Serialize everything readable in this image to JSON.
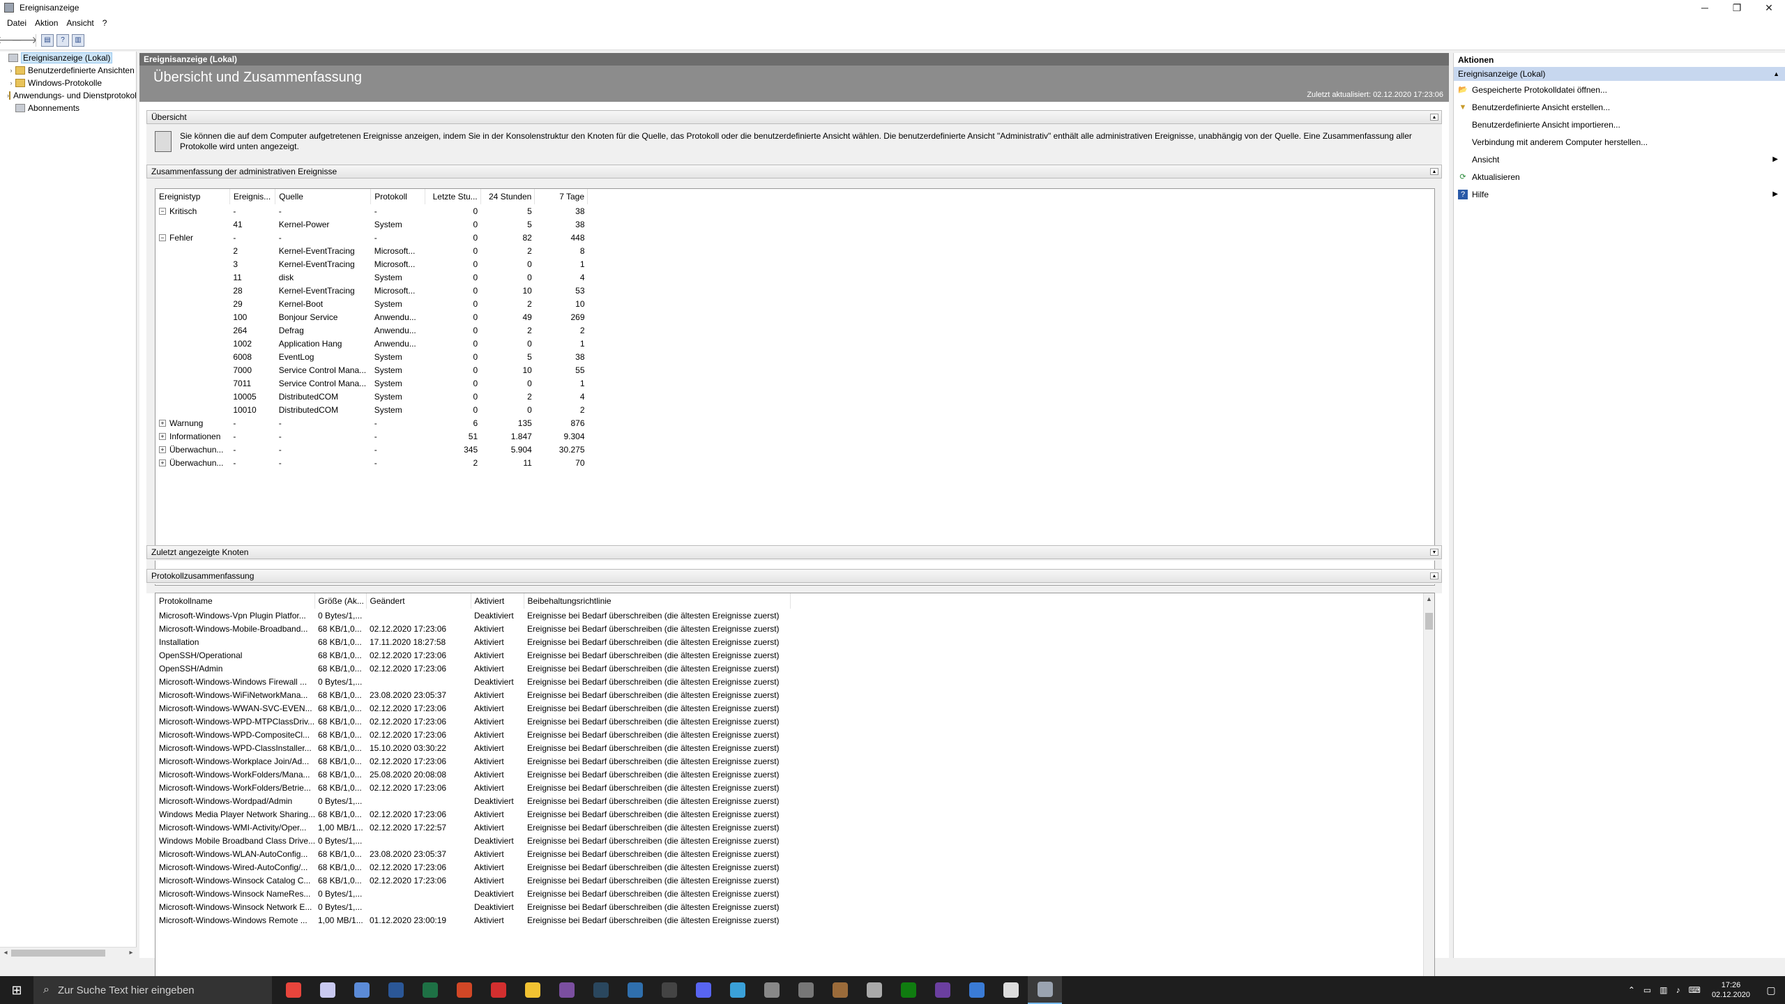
{
  "window": {
    "title": "Ereignisanzeige",
    "minimize": "─",
    "maximize": "❐",
    "close": "✕"
  },
  "menu": [
    "Datei",
    "Aktion",
    "Ansicht",
    "?"
  ],
  "toolbar": {
    "back": "🡐",
    "forward": "🡒",
    "help": "?"
  },
  "tree": {
    "root": "Ereignisanzeige (Lokal)",
    "items": [
      "Benutzerdefinierte Ansichten",
      "Windows-Protokolle",
      "Anwendungs- und Dienstprotokolle",
      "Abonnements"
    ]
  },
  "center": {
    "header": "Ereignisanzeige (Lokal)",
    "banner_title": "Übersicht und Zusammenfassung",
    "last_updated": "Zuletzt aktualisiert: 02.12.2020 17:23:06",
    "overview": {
      "title": "Übersicht",
      "text": "Sie können die auf dem Computer aufgetretenen Ereignisse anzeigen, indem Sie in der Konsolenstruktur den Knoten für die Quelle, das Protokoll oder die benutzerdefinierte Ansicht wählen. Die benutzerdefinierte Ansicht \"Administrativ\" enthält alle administrativen Ereignisse, unabhängig von der Quelle. Eine Zusammenfassung aller Protokolle wird unten angezeigt."
    },
    "admin_summary": {
      "title": "Zusammenfassung der administrativen Ereignisse",
      "columns": [
        "Ereignistyp",
        "Ereignis...",
        "Quelle",
        "Protokoll",
        "Letzte Stu...",
        "24 Stunden",
        "7 Tage"
      ],
      "rows": [
        {
          "type": "Kritisch",
          "toggle": "−",
          "id": "-",
          "source": "-",
          "log": "-",
          "hour": "0",
          "day": "5",
          "week": "38"
        },
        {
          "type": "",
          "toggle": "",
          "id": "41",
          "source": "Kernel-Power",
          "log": "System",
          "hour": "0",
          "day": "5",
          "week": "38"
        },
        {
          "type": "Fehler",
          "toggle": "−",
          "id": "-",
          "source": "-",
          "log": "-",
          "hour": "0",
          "day": "82",
          "week": "448"
        },
        {
          "type": "",
          "toggle": "",
          "id": "2",
          "source": "Kernel-EventTracing",
          "log": "Microsoft...",
          "hour": "0",
          "day": "2",
          "week": "8"
        },
        {
          "type": "",
          "toggle": "",
          "id": "3",
          "source": "Kernel-EventTracing",
          "log": "Microsoft...",
          "hour": "0",
          "day": "0",
          "week": "1"
        },
        {
          "type": "",
          "toggle": "",
          "id": "11",
          "source": "disk",
          "log": "System",
          "hour": "0",
          "day": "0",
          "week": "4"
        },
        {
          "type": "",
          "toggle": "",
          "id": "28",
          "source": "Kernel-EventTracing",
          "log": "Microsoft...",
          "hour": "0",
          "day": "10",
          "week": "53"
        },
        {
          "type": "",
          "toggle": "",
          "id": "29",
          "source": "Kernel-Boot",
          "log": "System",
          "hour": "0",
          "day": "2",
          "week": "10"
        },
        {
          "type": "",
          "toggle": "",
          "id": "100",
          "source": "Bonjour Service",
          "log": "Anwendu...",
          "hour": "0",
          "day": "49",
          "week": "269"
        },
        {
          "type": "",
          "toggle": "",
          "id": "264",
          "source": "Defrag",
          "log": "Anwendu...",
          "hour": "0",
          "day": "2",
          "week": "2"
        },
        {
          "type": "",
          "toggle": "",
          "id": "1002",
          "source": "Application Hang",
          "log": "Anwendu...",
          "hour": "0",
          "day": "0",
          "week": "1"
        },
        {
          "type": "",
          "toggle": "",
          "id": "6008",
          "source": "EventLog",
          "log": "System",
          "hour": "0",
          "day": "5",
          "week": "38"
        },
        {
          "type": "",
          "toggle": "",
          "id": "7000",
          "source": "Service Control Mana...",
          "log": "System",
          "hour": "0",
          "day": "10",
          "week": "55"
        },
        {
          "type": "",
          "toggle": "",
          "id": "7011",
          "source": "Service Control Mana...",
          "log": "System",
          "hour": "0",
          "day": "0",
          "week": "1"
        },
        {
          "type": "",
          "toggle": "",
          "id": "10005",
          "source": "DistributedCOM",
          "log": "System",
          "hour": "0",
          "day": "2",
          "week": "4"
        },
        {
          "type": "",
          "toggle": "",
          "id": "10010",
          "source": "DistributedCOM",
          "log": "System",
          "hour": "0",
          "day": "0",
          "week": "2"
        },
        {
          "type": "Warnung",
          "toggle": "+",
          "id": "-",
          "source": "-",
          "log": "-",
          "hour": "6",
          "day": "135",
          "week": "876"
        },
        {
          "type": "Informationen",
          "toggle": "+",
          "id": "-",
          "source": "-",
          "log": "-",
          "hour": "51",
          "day": "1.847",
          "week": "9.304"
        },
        {
          "type": "Überwachun...",
          "toggle": "+",
          "id": "-",
          "source": "-",
          "log": "-",
          "hour": "345",
          "day": "5.904",
          "week": "30.275"
        },
        {
          "type": "Überwachun...",
          "toggle": "+",
          "id": "-",
          "source": "-",
          "log": "-",
          "hour": "2",
          "day": "11",
          "week": "70"
        }
      ]
    },
    "recent_nodes": {
      "title": "Zuletzt angezeigte Knoten"
    },
    "log_summary": {
      "title": "Protokollzusammenfassung",
      "columns": [
        "Protokollname",
        "Größe (Ak...",
        "Geändert",
        "Aktiviert",
        "Beibehaltungsrichtlinie"
      ],
      "rows": [
        [
          "Microsoft-Windows-Vpn Plugin Platfor...",
          "0 Bytes/1,...",
          "",
          "Deaktiviert",
          "Ereignisse bei Bedarf überschreiben (die ältesten Ereignisse zuerst)"
        ],
        [
          "Microsoft-Windows-Mobile-Broadband...",
          "68 KB/1,0...",
          "02.12.2020 17:23:06",
          "Aktiviert",
          "Ereignisse bei Bedarf überschreiben (die ältesten Ereignisse zuerst)"
        ],
        [
          "Installation",
          "68 KB/1,0...",
          "17.11.2020 18:27:58",
          "Aktiviert",
          "Ereignisse bei Bedarf überschreiben (die ältesten Ereignisse zuerst)"
        ],
        [
          "OpenSSH/Operational",
          "68 KB/1,0...",
          "02.12.2020 17:23:06",
          "Aktiviert",
          "Ereignisse bei Bedarf überschreiben (die ältesten Ereignisse zuerst)"
        ],
        [
          "OpenSSH/Admin",
          "68 KB/1,0...",
          "02.12.2020 17:23:06",
          "Aktiviert",
          "Ereignisse bei Bedarf überschreiben (die ältesten Ereignisse zuerst)"
        ],
        [
          "Microsoft-Windows-Windows Firewall ...",
          "0 Bytes/1,...",
          "",
          "Deaktiviert",
          "Ereignisse bei Bedarf überschreiben (die ältesten Ereignisse zuerst)"
        ],
        [
          "Microsoft-Windows-WiFiNetworkMana...",
          "68 KB/1,0...",
          "23.08.2020 23:05:37",
          "Aktiviert",
          "Ereignisse bei Bedarf überschreiben (die ältesten Ereignisse zuerst)"
        ],
        [
          "Microsoft-Windows-WWAN-SVC-EVEN...",
          "68 KB/1,0...",
          "02.12.2020 17:23:06",
          "Aktiviert",
          "Ereignisse bei Bedarf überschreiben (die ältesten Ereignisse zuerst)"
        ],
        [
          "Microsoft-Windows-WPD-MTPClassDriv...",
          "68 KB/1,0...",
          "02.12.2020 17:23:06",
          "Aktiviert",
          "Ereignisse bei Bedarf überschreiben (die ältesten Ereignisse zuerst)"
        ],
        [
          "Microsoft-Windows-WPD-CompositeCl...",
          "68 KB/1,0...",
          "02.12.2020 17:23:06",
          "Aktiviert",
          "Ereignisse bei Bedarf überschreiben (die ältesten Ereignisse zuerst)"
        ],
        [
          "Microsoft-Windows-WPD-ClassInstaller...",
          "68 KB/1,0...",
          "15.10.2020 03:30:22",
          "Aktiviert",
          "Ereignisse bei Bedarf überschreiben (die ältesten Ereignisse zuerst)"
        ],
        [
          "Microsoft-Windows-Workplace Join/Ad...",
          "68 KB/1,0...",
          "02.12.2020 17:23:06",
          "Aktiviert",
          "Ereignisse bei Bedarf überschreiben (die ältesten Ereignisse zuerst)"
        ],
        [
          "Microsoft-Windows-WorkFolders/Mana...",
          "68 KB/1,0...",
          "25.08.2020 20:08:08",
          "Aktiviert",
          "Ereignisse bei Bedarf überschreiben (die ältesten Ereignisse zuerst)"
        ],
        [
          "Microsoft-Windows-WorkFolders/Betrie...",
          "68 KB/1,0...",
          "02.12.2020 17:23:06",
          "Aktiviert",
          "Ereignisse bei Bedarf überschreiben (die ältesten Ereignisse zuerst)"
        ],
        [
          "Microsoft-Windows-Wordpad/Admin",
          "0 Bytes/1,...",
          "",
          "Deaktiviert",
          "Ereignisse bei Bedarf überschreiben (die ältesten Ereignisse zuerst)"
        ],
        [
          "Windows Media Player Network Sharing...",
          "68 KB/1,0...",
          "02.12.2020 17:23:06",
          "Aktiviert",
          "Ereignisse bei Bedarf überschreiben (die ältesten Ereignisse zuerst)"
        ],
        [
          "Microsoft-Windows-WMI-Activity/Oper...",
          "1,00 MB/1...",
          "02.12.2020 17:22:57",
          "Aktiviert",
          "Ereignisse bei Bedarf überschreiben (die ältesten Ereignisse zuerst)"
        ],
        [
          "Windows Mobile Broadband Class Drive...",
          "0 Bytes/1,...",
          "",
          "Deaktiviert",
          "Ereignisse bei Bedarf überschreiben (die ältesten Ereignisse zuerst)"
        ],
        [
          "Microsoft-Windows-WLAN-AutoConfig...",
          "68 KB/1,0...",
          "23.08.2020 23:05:37",
          "Aktiviert",
          "Ereignisse bei Bedarf überschreiben (die ältesten Ereignisse zuerst)"
        ],
        [
          "Microsoft-Windows-Wired-AutoConfig/...",
          "68 KB/1,0...",
          "02.12.2020 17:23:06",
          "Aktiviert",
          "Ereignisse bei Bedarf überschreiben (die ältesten Ereignisse zuerst)"
        ],
        [
          "Microsoft-Windows-Winsock Catalog C...",
          "68 KB/1,0...",
          "02.12.2020 17:23:06",
          "Aktiviert",
          "Ereignisse bei Bedarf überschreiben (die ältesten Ereignisse zuerst)"
        ],
        [
          "Microsoft-Windows-Winsock NameRes...",
          "0 Bytes/1,...",
          "",
          "Deaktiviert",
          "Ereignisse bei Bedarf überschreiben (die ältesten Ereignisse zuerst)"
        ],
        [
          "Microsoft-Windows-Winsock Network E...",
          "0 Bytes/1,...",
          "",
          "Deaktiviert",
          "Ereignisse bei Bedarf überschreiben (die ältesten Ereignisse zuerst)"
        ],
        [
          "Microsoft-Windows-Windows Remote ...",
          "1,00 MB/1...",
          "01.12.2020 23:00:19",
          "Aktiviert",
          "Ereignisse bei Bedarf überschreiben (die ältesten Ereignisse zuerst)"
        ]
      ]
    }
  },
  "actions": {
    "title": "Aktionen",
    "group": "Ereignisanzeige (Lokal)",
    "items": [
      {
        "label": "Gespeicherte Protokolldatei öffnen...",
        "icon": "open-log-icon",
        "submenu": false
      },
      {
        "label": "Benutzerdefinierte Ansicht erstellen...",
        "icon": "filter-icon",
        "submenu": false
      },
      {
        "label": "Benutzerdefinierte Ansicht importieren...",
        "icon": "",
        "submenu": false
      },
      {
        "label": "Verbindung mit anderem Computer herstellen...",
        "icon": "",
        "submenu": false
      },
      {
        "label": "Ansicht",
        "icon": "",
        "submenu": true
      },
      {
        "label": "Aktualisieren",
        "icon": "refresh-icon",
        "submenu": false
      },
      {
        "label": "Hilfe",
        "icon": "help-icon",
        "submenu": true
      }
    ]
  },
  "taskbar": {
    "search_placeholder": "Zur Suche Text hier eingeben",
    "apps": [
      {
        "name": "chrome-icon",
        "color": "#e8453c"
      },
      {
        "name": "itunes-icon",
        "color": "#c9c9f0"
      },
      {
        "name": "calculator-icon",
        "color": "#5b8bd8"
      },
      {
        "name": "word-icon",
        "color": "#2b5797"
      },
      {
        "name": "excel-icon",
        "color": "#1e7145"
      },
      {
        "name": "powerpoint-icon",
        "color": "#d24726"
      },
      {
        "name": "acrobat-icon",
        "color": "#d32f2f"
      },
      {
        "name": "explorer-icon",
        "color": "#f1c232"
      },
      {
        "name": "app-icon-purple",
        "color": "#7b4fa0"
      },
      {
        "name": "steam-icon",
        "color": "#2a475e"
      },
      {
        "name": "app-icon-blue",
        "color": "#2f6fad"
      },
      {
        "name": "epic-icon",
        "color": "#444444"
      },
      {
        "name": "discord-icon",
        "color": "#5865f2"
      },
      {
        "name": "app-icon-globe",
        "color": "#3aa0d8"
      },
      {
        "name": "settings-icon",
        "color": "#888888"
      },
      {
        "name": "app-icon-return",
        "color": "#777777"
      },
      {
        "name": "app-icon-shield",
        "color": "#9b6b3a"
      },
      {
        "name": "app-icon-pen",
        "color": "#aaaaaa"
      },
      {
        "name": "xbox-icon",
        "color": "#107c10"
      },
      {
        "name": "app-icon-violet",
        "color": "#6b3fa0"
      },
      {
        "name": "app-icon-monitor",
        "color": "#3a7bd5"
      },
      {
        "name": "notepad-icon",
        "color": "#dddddd"
      },
      {
        "name": "event-viewer-icon",
        "color": "#9aa3b0"
      }
    ],
    "time": "17:26",
    "date": "02.12.2020"
  }
}
